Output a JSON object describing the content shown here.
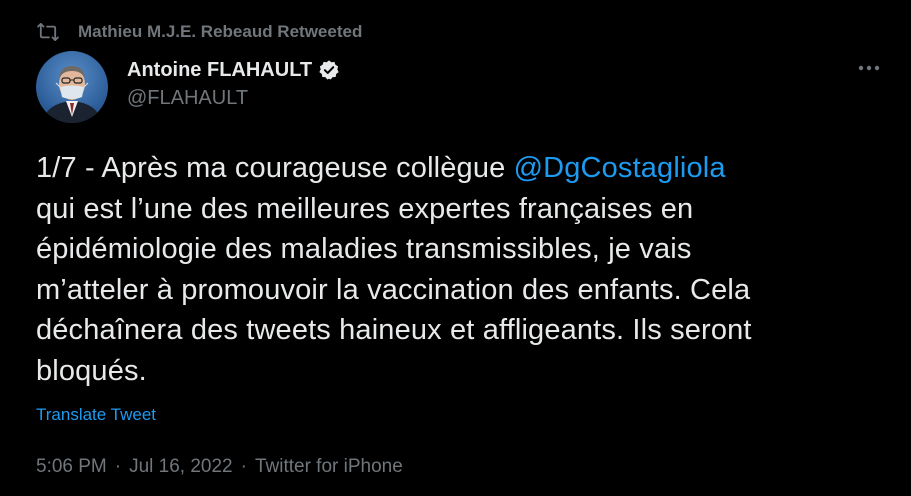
{
  "retweet": {
    "label": "Mathieu M.J.E. Rebeaud Retweeted",
    "icon": "retweet-icon"
  },
  "author": {
    "name": "Antoine FLAHAULT",
    "handle": "@FLAHAULT",
    "verified": true,
    "avatar_icon": "avatar-portrait"
  },
  "tweet": {
    "text_before_mention": "1/7 - Après ma courageuse collègue ",
    "mention": "@DgCostagliola",
    "text_after_mention": "\nqui est l’une des meilleures expertes françaises en\népidémiologie des maladies transmissibles, je vais\nm’atteler à promouvoir la vaccination des enfants. Cela\ndéchaînera des tweets haineux et affligeants. Ils seront\nbloqués.",
    "translate_label": "Translate Tweet"
  },
  "meta": {
    "time": "5:06 PM",
    "separator": "·",
    "date": "Jul 16, 2022",
    "source": "Twitter for iPhone"
  },
  "colors": {
    "background": "#000000",
    "text": "#e7e9ea",
    "muted": "#71767b",
    "accent": "#1d9bf0"
  }
}
